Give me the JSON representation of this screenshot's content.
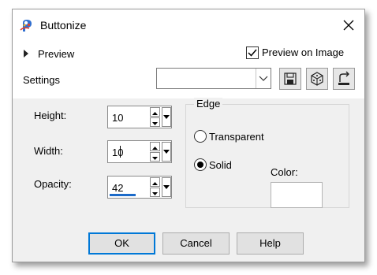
{
  "window": {
    "title": "Buttonize"
  },
  "preview": {
    "label": "Preview",
    "preview_on_image_label": "Preview on Image",
    "preview_on_image_checked": true
  },
  "settings": {
    "label": "Settings",
    "selected": ""
  },
  "fields": {
    "height": {
      "label": "Height:",
      "value": "10"
    },
    "width": {
      "label": "Width:",
      "value": "10"
    },
    "opacity": {
      "label": "Opacity:",
      "value": "42"
    }
  },
  "edge": {
    "legend": "Edge",
    "options": [
      {
        "label": "Transparent",
        "selected": false
      },
      {
        "label": "Solid",
        "selected": true
      }
    ],
    "color_label": "Color:",
    "color_value": "#ffffff"
  },
  "buttons": {
    "ok": "OK",
    "cancel": "Cancel",
    "help": "Help"
  },
  "icons": {
    "app": "paint-palette-icon",
    "close": "close-icon",
    "save_preset": "floppy-disk-icon",
    "randomize": "dice-icon",
    "reset": "reset-icon"
  },
  "colors": {
    "accent": "#0078d7",
    "background": "#f0f0f0"
  }
}
